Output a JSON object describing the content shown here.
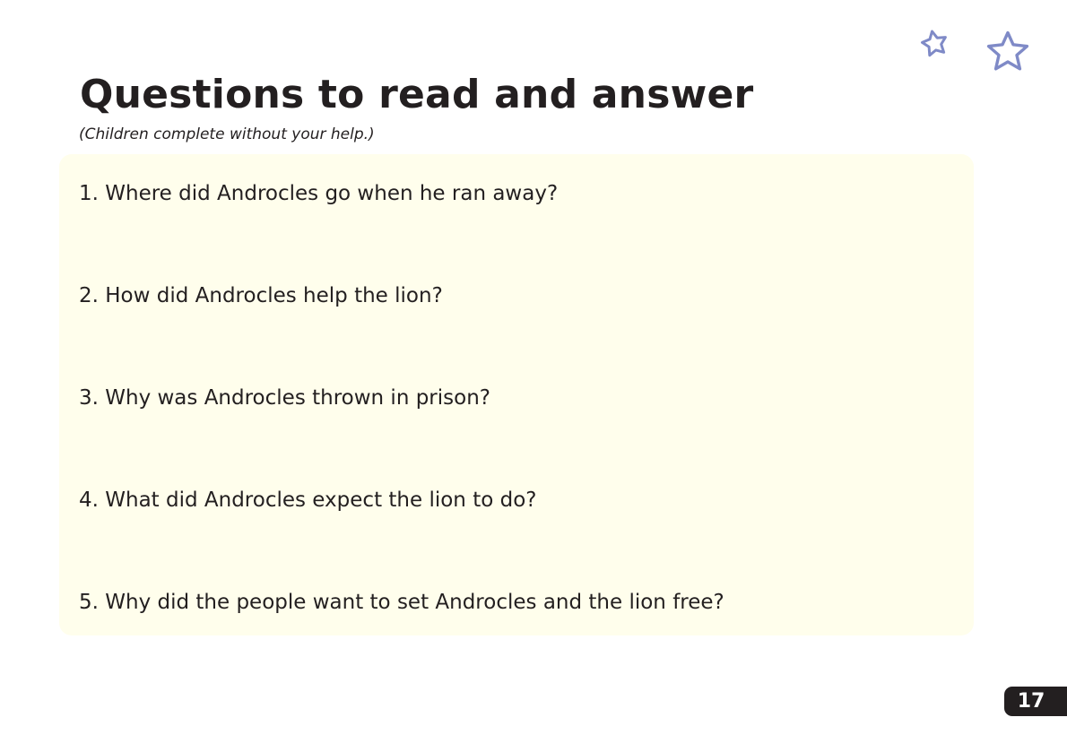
{
  "page": {
    "title": "Questions to read and answer",
    "subtitle": "(Children complete without your help.)",
    "page_number": "17"
  },
  "questions": [
    "1. Where did Androcles go when he ran away?",
    "2. How did Androcles help the lion?",
    "3. Why was Androcles thrown in prison?",
    "4. What did Androcles expect the lion to do?",
    "5. Why did the people want to set Androcles and the lion free?"
  ],
  "decorations": {
    "icons": [
      "star-outline-icon",
      "star-outline-icon"
    ],
    "star_color": "#7f8ac7",
    "panel_color": "#fffeec"
  }
}
